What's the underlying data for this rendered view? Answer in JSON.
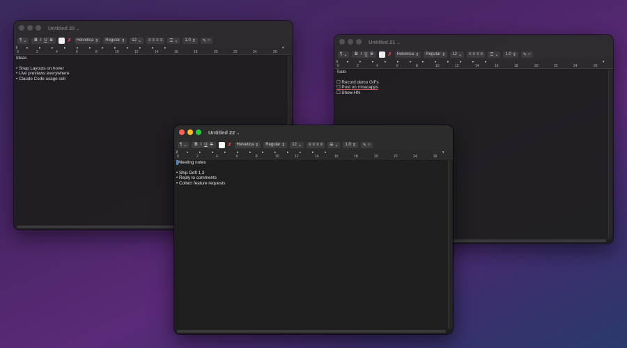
{
  "windows": [
    {
      "title": "Untitled 20",
      "lines": [
        "Ideas",
        "",
        "• Snap Layouts on hover",
        "• Live previews everywhere",
        "• Claude Code usage cell"
      ]
    },
    {
      "title": "Untitled 21",
      "lines": [
        "Todo",
        "",
        "☐ Record demo GIFs",
        "☐ Post on r/macapps",
        "☐ Show HN"
      ]
    },
    {
      "title": "Untitled 22",
      "lines": [
        "Meeting notes",
        "",
        "• Ship Deft 1.3",
        "• Reply to comments",
        "• Collect feature requests"
      ]
    }
  ],
  "toolbar": {
    "paragraph_label": "¶",
    "bold": "B",
    "italic": "I",
    "underline": "U",
    "strike": "S",
    "font": "Helvetica",
    "style": "Regular",
    "size": "12",
    "spacing": "1.0"
  },
  "ruler": {
    "numbers": [
      "0",
      "2",
      "4",
      "6",
      "8",
      "10",
      "12",
      "14",
      "16",
      "18",
      "20",
      "22",
      "24",
      "26"
    ]
  },
  "icons": {
    "chevron": "chevron-down-icon",
    "stepper": "stepper-icon"
  }
}
